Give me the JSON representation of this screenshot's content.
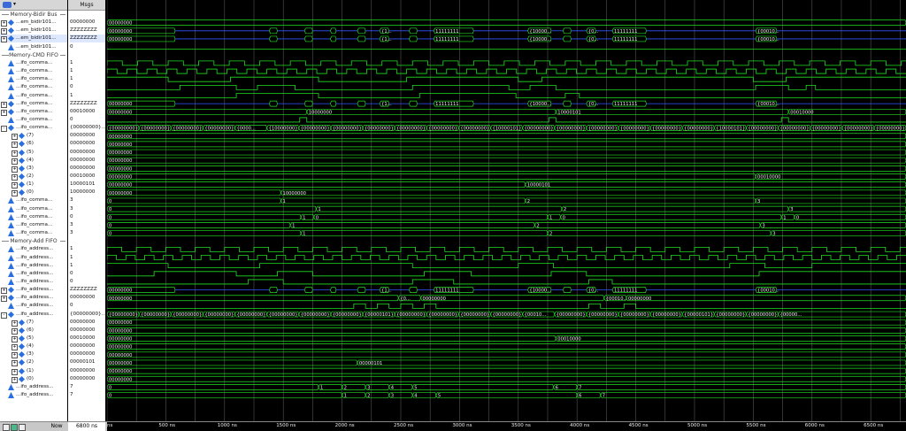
{
  "header": {
    "msgs_label": "Msgs"
  },
  "rows": [
    {
      "type": "group",
      "label": "Memory-Bidir Bus"
    },
    {
      "name": "...em_bidir101...",
      "value": "00000000",
      "exp": "+",
      "icon": "bus"
    },
    {
      "name": "...em_bidir101...",
      "value": "ZZZZZZZZ",
      "exp": "+",
      "icon": "bus"
    },
    {
      "name": "...em_bidir101...",
      "value": "ZZZZZZZZ",
      "exp": "+",
      "icon": "bus",
      "selected": true
    },
    {
      "name": "...em_bidir101...",
      "value": "0",
      "icon": "sig"
    },
    {
      "type": "group",
      "label": "Memory-CMD FIFO"
    },
    {
      "name": "...ifo_comma...",
      "value": "1",
      "icon": "sig"
    },
    {
      "name": "...ifo_comma...",
      "value": "1",
      "icon": "sig"
    },
    {
      "name": "...ifo_comma...",
      "value": "1",
      "icon": "sig"
    },
    {
      "name": "...ifo_comma...",
      "value": "0",
      "icon": "sig"
    },
    {
      "name": "...ifo_comma...",
      "value": "1",
      "icon": "sig"
    },
    {
      "name": "...ifo_comma...",
      "value": "ZZZZZZZZ",
      "exp": "+",
      "icon": "bus"
    },
    {
      "name": "...ifo_comma...",
      "value": "00010000",
      "exp": "+",
      "icon": "bus"
    },
    {
      "name": "...ifo_comma...",
      "value": "0",
      "icon": "sig"
    },
    {
      "name": "...ifo_comma...",
      "value": "{00000000}...",
      "exp": "-",
      "icon": "bus"
    },
    {
      "name": "(7)",
      "value": "00000000",
      "exp": "+",
      "icon": "sub"
    },
    {
      "name": "(6)",
      "value": "00000000",
      "exp": "+",
      "icon": "sub"
    },
    {
      "name": "(5)",
      "value": "00000000",
      "exp": "+",
      "icon": "sub"
    },
    {
      "name": "(4)",
      "value": "00000000",
      "exp": "+",
      "icon": "sub"
    },
    {
      "name": "(3)",
      "value": "00000000",
      "exp": "+",
      "icon": "sub"
    },
    {
      "name": "(2)",
      "value": "00010000",
      "exp": "+",
      "icon": "sub"
    },
    {
      "name": "(1)",
      "value": "10000101",
      "exp": "+",
      "icon": "sub"
    },
    {
      "name": "(0)",
      "value": "10000000",
      "exp": "+",
      "icon": "sub"
    },
    {
      "name": "...ifo_comma...",
      "value": "3",
      "icon": "sig"
    },
    {
      "name": "...ifo_comma...",
      "value": "3",
      "icon": "sig"
    },
    {
      "name": "...ifo_comma...",
      "value": "0",
      "icon": "sig"
    },
    {
      "name": "...ifo_comma...",
      "value": "3",
      "icon": "sig"
    },
    {
      "name": "...ifo_comma...",
      "value": "3",
      "icon": "sig"
    },
    {
      "type": "group",
      "label": "Memory-Add FIFO"
    },
    {
      "name": "...ifo_address...",
      "value": "1",
      "icon": "sig"
    },
    {
      "name": "...ifo_address...",
      "value": "1",
      "icon": "sig"
    },
    {
      "name": "...ifo_address...",
      "value": "1",
      "icon": "sig"
    },
    {
      "name": "...ifo_address...",
      "value": "0",
      "icon": "sig"
    },
    {
      "name": "...ifo_address...",
      "value": "0",
      "icon": "sig"
    },
    {
      "name": "...ifo_address...",
      "value": "ZZZZZZZZ",
      "exp": "+",
      "icon": "bus"
    },
    {
      "name": "...ifo_address...",
      "value": "00000000",
      "exp": "+",
      "icon": "bus"
    },
    {
      "name": "...ifo_address...",
      "value": "0",
      "icon": "sig"
    },
    {
      "name": "...ifo_address...",
      "value": "{00000000}...",
      "exp": "-",
      "icon": "bus"
    },
    {
      "name": "(7)",
      "value": "00000000",
      "exp": "+",
      "icon": "sub"
    },
    {
      "name": "(6)",
      "value": "00000000",
      "exp": "+",
      "icon": "sub"
    },
    {
      "name": "(5)",
      "value": "00010000",
      "exp": "+",
      "icon": "sub"
    },
    {
      "name": "(4)",
      "value": "00000000",
      "exp": "+",
      "icon": "sub"
    },
    {
      "name": "(3)",
      "value": "00000000",
      "exp": "+",
      "icon": "sub"
    },
    {
      "name": "(2)",
      "value": "00000101",
      "exp": "+",
      "icon": "sub"
    },
    {
      "name": "(1)",
      "value": "00000000",
      "exp": "+",
      "icon": "sub"
    },
    {
      "name": "(0)",
      "value": "00000000",
      "exp": "+",
      "icon": "sub"
    },
    {
      "name": "...ifo_address...",
      "value": "7",
      "icon": "sig"
    },
    {
      "name": "...ifo_address...",
      "value": "7",
      "icon": "sig"
    }
  ],
  "footer": {
    "now_label": "Now",
    "now_value": "6800 ns"
  },
  "timeline": {
    "ticks": [
      "ns",
      "500 ns",
      "1000 ns",
      "1500 ns",
      "2000 ns",
      "2500 ns",
      "3000 ns",
      "3500 ns",
      "4000 ns",
      "4500 ns",
      "5000 ns",
      "5500 ns",
      "6000 ns",
      "6500 ns"
    ],
    "max_ns": 6800
  },
  "bus_labels": {
    "zero": "00000000",
    "ones": "11111111",
    "partial": "{1...",
    "partial0": "{0...",
    "partial10": "{10000...",
    "partial100": "{00010...",
    "hex80": "10000000",
    "hex85": "10000101",
    "hex10": "00010000",
    "hex05": "00000101",
    "array_seg": "{00000000}",
    "array_seg_a": "{10000101}",
    "array_seg_b": "{00010000}",
    "array_seg_c": "{10000000}",
    "array_seg_d": "{0000...",
    "array_seg_e": "{00000101}",
    "array_seg_f": "{00010...",
    "addr_seg": "{00000...",
    "n0": "0",
    "n1": "1",
    "n2": "2",
    "n3": "3",
    "n4": "4",
    "n5": "5",
    "n6": "6",
    "n7": "7"
  },
  "colors": {
    "wave": "#22dd22",
    "zbus": "#3355ff",
    "grid": "#555555",
    "text": "#eeeeee"
  }
}
